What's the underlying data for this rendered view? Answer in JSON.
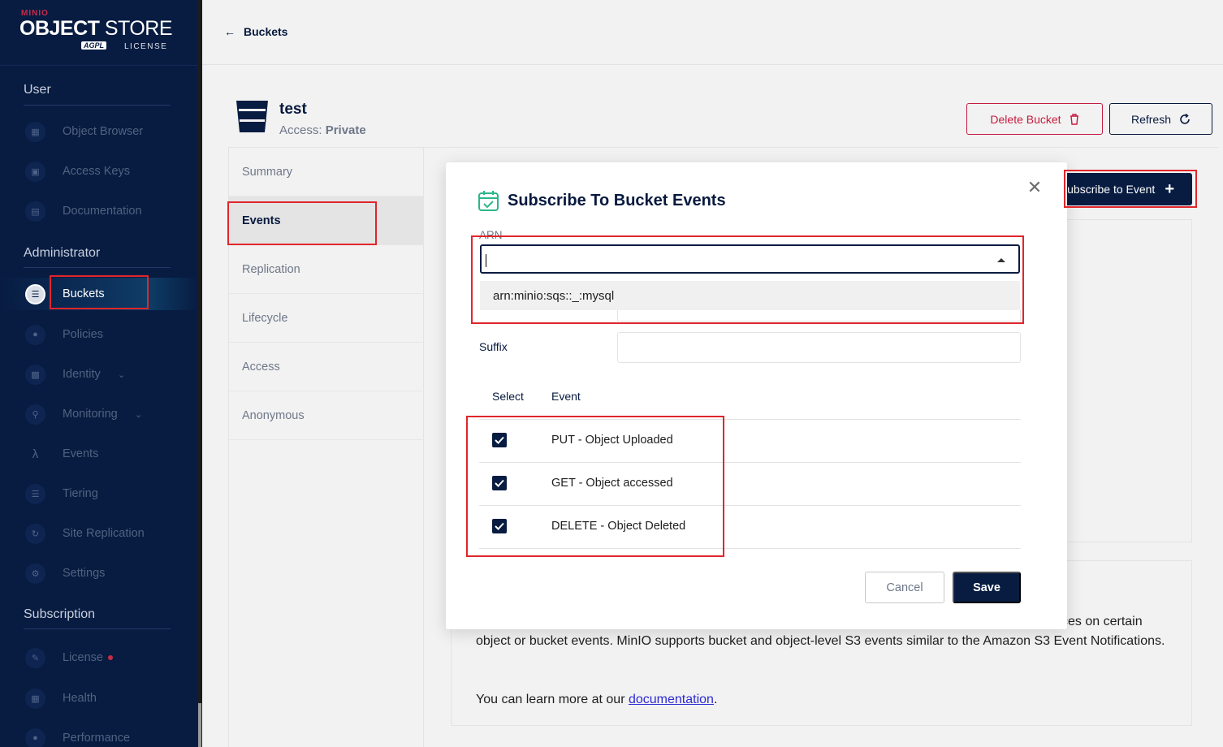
{
  "logo": {
    "brand": "MINIO",
    "product_bold": "OBJECT",
    "product_thin": " STORE",
    "badge": "AGPL",
    "license": "LICENSE"
  },
  "sidebar": {
    "sections": [
      {
        "title": "User"
      },
      {
        "title": "Administrator"
      },
      {
        "title": "Subscription"
      }
    ],
    "items": [
      {
        "label": "Object Browser",
        "icon": "object-browser-icon"
      },
      {
        "label": "Access Keys",
        "icon": "access-keys-icon"
      },
      {
        "label": "Documentation",
        "icon": "documentation-icon"
      },
      {
        "label": "Buckets",
        "icon": "buckets-icon",
        "active": true
      },
      {
        "label": "Policies",
        "icon": "policies-icon"
      },
      {
        "label": "Identity",
        "icon": "identity-icon",
        "expandable": true
      },
      {
        "label": "Monitoring",
        "icon": "monitoring-icon",
        "expandable": true
      },
      {
        "label": "Events",
        "icon": "lambda-icon"
      },
      {
        "label": "Tiering",
        "icon": "tiering-icon"
      },
      {
        "label": "Site Replication",
        "icon": "site-replication-icon"
      },
      {
        "label": "Settings",
        "icon": "settings-icon"
      },
      {
        "label": "License",
        "icon": "license-icon",
        "badge_dot": true
      },
      {
        "label": "Health",
        "icon": "health-icon"
      },
      {
        "label": "Performance",
        "icon": "performance-icon"
      }
    ]
  },
  "topbar": {
    "back_label": "Buckets"
  },
  "bucket": {
    "name": "test",
    "access_label": "Access:",
    "access_value": "Private"
  },
  "actions": {
    "delete_label": "Delete Bucket",
    "refresh_label": "Refresh",
    "subscribe_label": "Subscribe to Event"
  },
  "tabs": [
    {
      "label": "Summary"
    },
    {
      "label": "Events",
      "active": true
    },
    {
      "label": "Replication"
    },
    {
      "label": "Lifecycle"
    },
    {
      "label": "Access"
    },
    {
      "label": "Anonymous"
    }
  ],
  "help": {
    "line1_tail": "ces on certain",
    "body": "object or bucket events. MinIO supports bucket and object-level S3 events similar to the Amazon S3 Event Notifications.",
    "learn_prefix": "You can learn more at our ",
    "learn_link": "documentation",
    "learn_suffix": "."
  },
  "modal": {
    "title": "Subscribe To Bucket Events",
    "arn_label": "ARN",
    "arn_value": "",
    "arn_options": [
      "arn:minio:sqs::_:mysql"
    ],
    "suffix_label": "Suffix",
    "suffix_value": "",
    "table_headers": {
      "select": "Select",
      "event": "Event"
    },
    "events": [
      {
        "label": "PUT - Object Uploaded",
        "checked": true
      },
      {
        "label": "GET - Object accessed",
        "checked": true
      },
      {
        "label": "DELETE - Object Deleted",
        "checked": true
      }
    ],
    "cancel_label": "Cancel",
    "save_label": "Save"
  },
  "colors": {
    "sidebar_bg": "#081c42",
    "accent_red": "#c51b3f",
    "highlight_red": "#e0262b",
    "primary": "#081c42"
  }
}
